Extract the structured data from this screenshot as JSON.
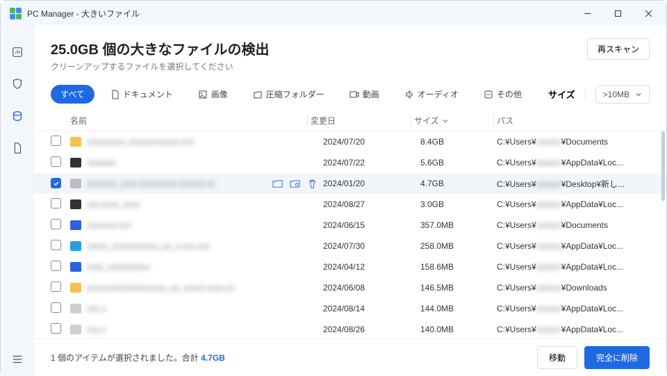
{
  "window": {
    "title": "PC Manager - 大きいファイル"
  },
  "header": {
    "title": "25.0GB 個の大きなファイルの検出",
    "subtitle": "クリーンアップするファイルを選択してください",
    "rescan": "再スキャン"
  },
  "filters": {
    "all": "すべて",
    "items": [
      {
        "label": "ドキュメント",
        "icon": "document-icon"
      },
      {
        "label": "画像",
        "icon": "image-icon"
      },
      {
        "label": "圧縮フォルダー",
        "icon": "archive-icon"
      },
      {
        "label": "動画",
        "icon": "video-icon"
      },
      {
        "label": "オーディオ",
        "icon": "audio-icon"
      },
      {
        "label": "その他",
        "icon": "other-icon"
      }
    ],
    "size_label": "サイズ",
    "size_value": ">10MB"
  },
  "columns": {
    "name": "名前",
    "date": "変更日",
    "size": "サイズ",
    "path": "パス"
  },
  "rows": [
    {
      "checked": false,
      "icon": "#f5c24d",
      "name": "xxxxxxxxx_xxxxxxxxxxxx.xxx",
      "date": "2024/07/20",
      "size": "8.4GB",
      "path_mid": "xxxxxx",
      "path_tail": "¥Documents"
    },
    {
      "checked": false,
      "icon": "#333333",
      "name": "xxxxxxx",
      "date": "2024/07/22",
      "size": "5.6GB",
      "path_mid": "xxxxxx",
      "path_tail": "¥AppData¥Loc..."
    },
    {
      "checked": true,
      "selected": true,
      "icon": "#bdbdbd",
      "name": "xxxxxxx_xxxx xxxxxxxxx xxxxxx xx",
      "date": "2024/01/20",
      "size": "4.7GB",
      "path_mid": "xxxxxx",
      "path_tail": "¥Desktop¥新し..."
    },
    {
      "checked": false,
      "icon": "#333333",
      "name": "xxx.xxxx_xxxx",
      "date": "2024/08/27",
      "size": "3.0GB",
      "path_mid": "xxxxxx",
      "path_tail": "¥AppData¥Loc..."
    },
    {
      "checked": false,
      "icon": "#2a63e2",
      "name": "xxxxxxx.xxx",
      "date": "2024/06/15",
      "size": "357.0MB",
      "path_mid": "xxxxxx",
      "path_tail": "¥Documents"
    },
    {
      "checked": false,
      "icon": "#2a9de2",
      "name": "xxxxx_xxxxxxxxxxx_xx_x.xxx.xxx",
      "date": "2024/07/30",
      "size": "258.0MB",
      "path_mid": "xxxxxx",
      "path_tail": "¥AppData¥Loc..."
    },
    {
      "checked": false,
      "icon": "#2a63e2",
      "name": "xxxx_xxxxxxxxxx",
      "date": "2024/04/12",
      "size": "158.6MB",
      "path_mid": "xxxxxx",
      "path_tail": "¥AppData¥Loc..."
    },
    {
      "checked": false,
      "icon": "#f5c24d",
      "name": "xxxxxxxxxxxxxxxxxxx_xx_xxxxx.xxxx.xx",
      "date": "2024/06/08",
      "size": "146.5MB",
      "path_mid": "xxxxxx",
      "path_tail": "¥Downloads"
    },
    {
      "checked": false,
      "icon": "#cfcfcf",
      "name": "xxx.x",
      "date": "2024/08/14",
      "size": "144.0MB",
      "path_mid": "xxxxxx",
      "path_tail": "¥AppData¥Loc..."
    },
    {
      "checked": false,
      "icon": "#cfcfcf",
      "name": "xxx.x",
      "date": "2024/08/26",
      "size": "140.0MB",
      "path_mid": "xxxxxx",
      "path_tail": "¥AppData¥Loc..."
    }
  ],
  "path_prefix": "C:¥Users¥",
  "footer": {
    "text_prefix": "1 個のアイテムが選択されました。合計 ",
    "total": "4.7GB",
    "move": "移動",
    "delete": "完全に削除"
  }
}
